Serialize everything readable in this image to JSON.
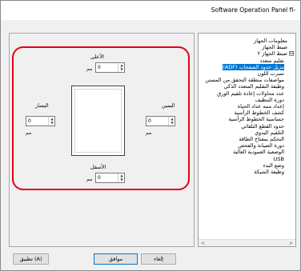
{
  "window": {
    "title": "Software Operation Panel fi-"
  },
  "tree": {
    "items": [
      {
        "label": "معلومات الجهاز",
        "depth": 1,
        "expander": "",
        "selected": false
      },
      {
        "label": "ضبط الجهاز",
        "depth": 1,
        "expander": "",
        "selected": false
      },
      {
        "label": "ضبط الجهاز ٢",
        "depth": 1,
        "expander": "⊟",
        "selected": false
      },
      {
        "label": "تقليم متعدد",
        "depth": 2,
        "expander": "",
        "selected": false
      },
      {
        "label": "مزيل حدود الصفحات (ADF)",
        "depth": 2,
        "expander": "",
        "selected": true
      },
      {
        "label": "تسرب اللون",
        "depth": 2,
        "expander": "",
        "selected": false
      },
      {
        "label": "مواصفات منطقة التحقق من المستن",
        "depth": 2,
        "expander": "",
        "selected": false
      },
      {
        "label": "وظيفة التقليم المتعدد الذكي",
        "depth": 2,
        "expander": "",
        "selected": false
      },
      {
        "label": "عدد محاولات إعادة تلقيم الورق",
        "depth": 2,
        "expander": "",
        "selected": false
      },
      {
        "label": "دورة التنظيف",
        "depth": 2,
        "expander": "",
        "selected": false
      },
      {
        "label": "إعداد منبه عداد الحياة",
        "depth": 2,
        "expander": "",
        "selected": false
      },
      {
        "label": "كشف الخطوط الرأسية",
        "depth": 2,
        "expander": "",
        "selected": false
      },
      {
        "label": "حساسية الخطوط الرأسية",
        "depth": 2,
        "expander": "",
        "selected": false
      },
      {
        "label": "حدود القطع التلقائي",
        "depth": 2,
        "expander": "",
        "selected": false
      },
      {
        "label": "التلقيم اليدوي",
        "depth": 2,
        "expander": "",
        "selected": false
      },
      {
        "label": "التحكم بمفتاح الطاقة",
        "depth": 2,
        "expander": "",
        "selected": false
      },
      {
        "label": "دورة الصيانة والفحص",
        "depth": 2,
        "expander": "",
        "selected": false
      },
      {
        "label": "الوضعية العمودية العالية",
        "depth": 2,
        "expander": "",
        "selected": false
      },
      {
        "label": "USB",
        "depth": 2,
        "expander": "",
        "selected": false
      },
      {
        "label": "وضع البدء",
        "depth": 2,
        "expander": "",
        "selected": false
      },
      {
        "label": "وظيفة الشبكة",
        "depth": 2,
        "expander": "",
        "selected": false
      }
    ],
    "scroll_left": "<",
    "scroll_right": ">"
  },
  "margins": {
    "top": {
      "label": "الأعلى",
      "value": "0",
      "unit": "مم"
    },
    "left": {
      "label": "اليسار",
      "value": "0",
      "unit": "مم"
    },
    "right": {
      "label": "اليمين",
      "value": "0",
      "unit": "مم"
    },
    "bottom": {
      "label": "الأسفل",
      "value": "0",
      "unit": "مم"
    }
  },
  "buttons": {
    "ok": "موافق",
    "cancel": "إلغاء",
    "apply": "تطبيق (A)"
  },
  "colors": {
    "highlight": "#e60012",
    "selection": "#0078d7"
  }
}
